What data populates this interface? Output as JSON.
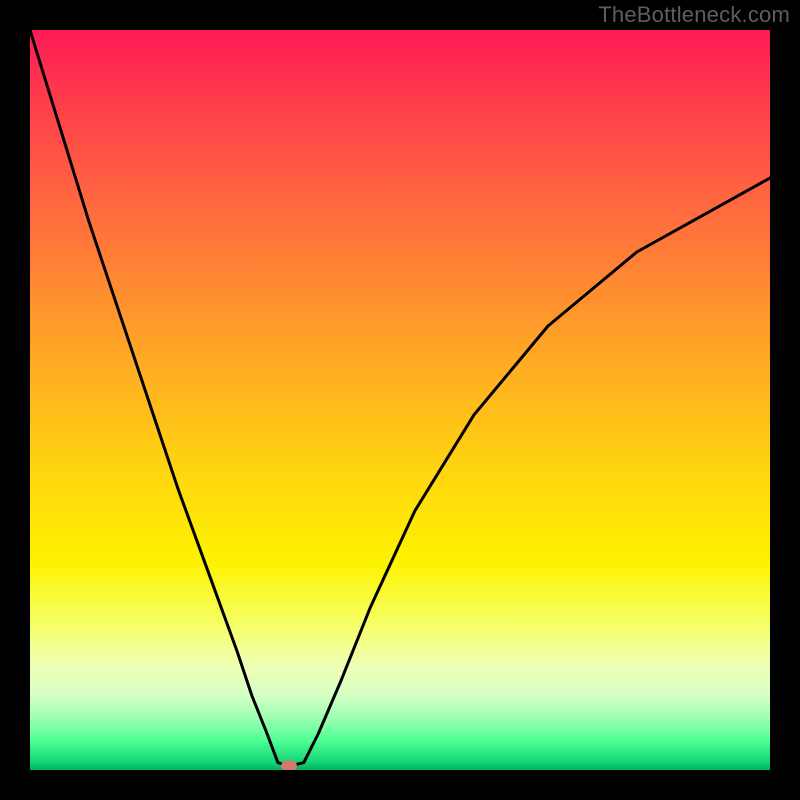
{
  "watermark": "TheBottleneck.com",
  "chart_data": {
    "type": "line",
    "title": "",
    "xlabel": "",
    "ylabel": "",
    "xlim": [
      0,
      100
    ],
    "ylim": [
      0,
      100
    ],
    "grid": false,
    "legend": false,
    "background_gradient": {
      "top": "#ff1a55",
      "mid": "#ffd60f",
      "bottom": "#00b060"
    },
    "series": [
      {
        "name": "curve",
        "color": "#000000",
        "x": [
          0,
          4,
          8,
          12,
          16,
          20,
          24,
          28,
          30,
          32,
          33.5,
          35,
          37,
          39,
          42,
          46,
          52,
          60,
          70,
          82,
          100
        ],
        "y": [
          100,
          87,
          74,
          62,
          50,
          38,
          27,
          16,
          10,
          5,
          1,
          0.5,
          1,
          5,
          12,
          22,
          35,
          48,
          60,
          70,
          80
        ]
      }
    ],
    "marker": {
      "x": 35,
      "y": 0.5,
      "color": "#d07a6a"
    }
  }
}
